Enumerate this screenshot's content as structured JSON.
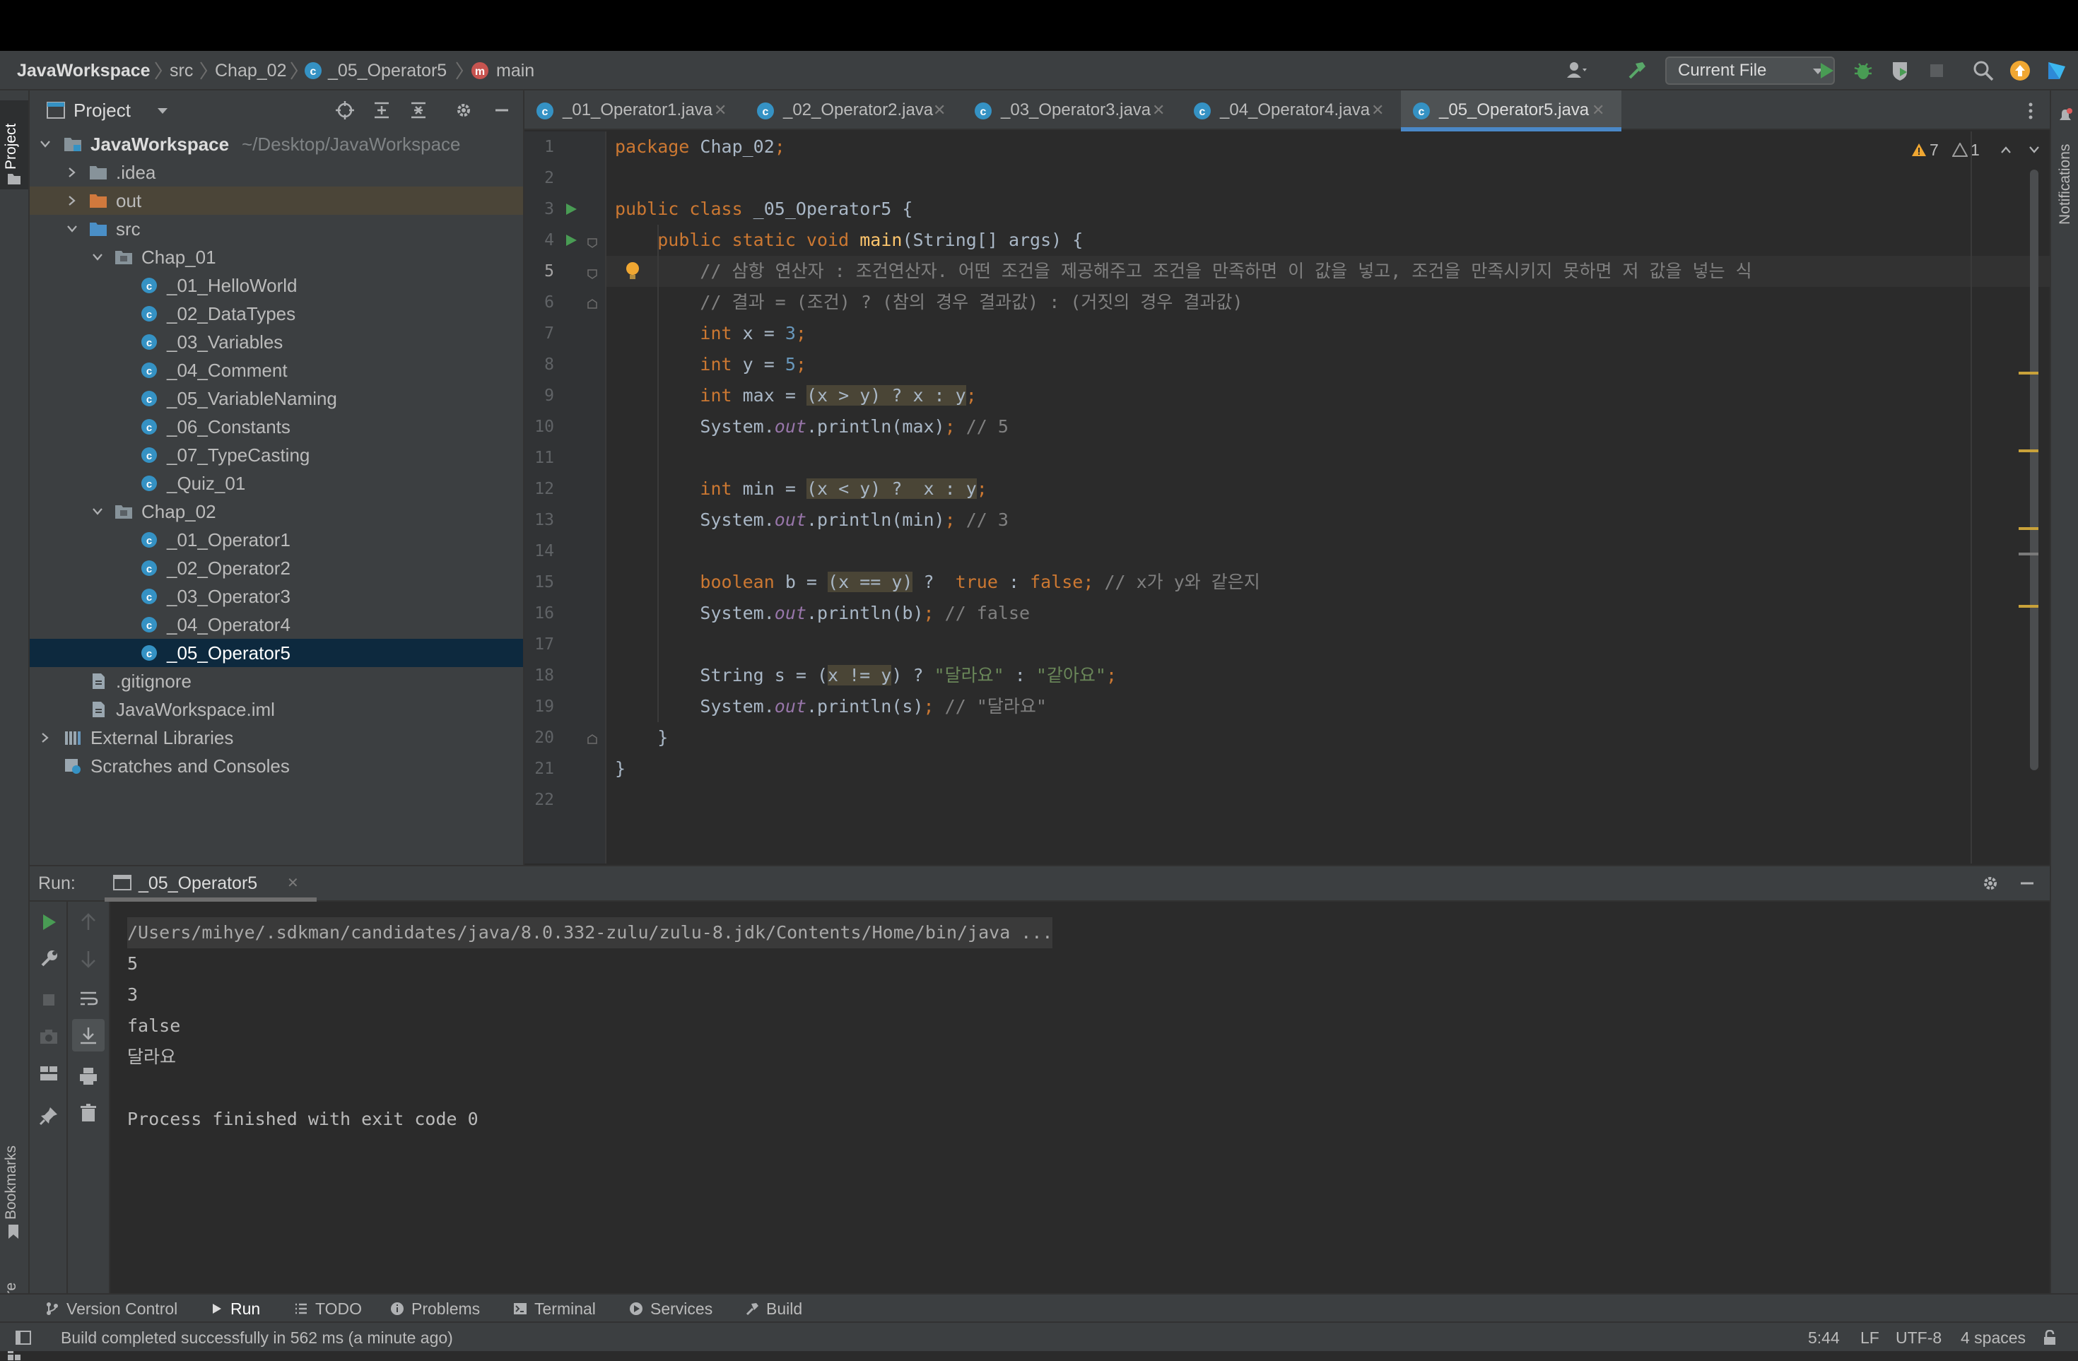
{
  "breadcrumb": {
    "project": "JavaWorkspace",
    "src": "src",
    "package": "Chap_02",
    "file": "_05_Operator5",
    "method": "main"
  },
  "run_config": {
    "label": "Current File"
  },
  "project_panel": {
    "title": "Project",
    "tree": [
      {
        "label": "JavaWorkspace",
        "path": "~/Desktop/JavaWorkspace"
      },
      {
        "label": ".idea"
      },
      {
        "label": "out"
      },
      {
        "label": "src"
      },
      {
        "label": "Chap_01"
      },
      {
        "label": "_01_HelloWorld"
      },
      {
        "label": "_02_DataTypes"
      },
      {
        "label": "_03_Variables"
      },
      {
        "label": "_04_Comment"
      },
      {
        "label": "_05_VariableNaming"
      },
      {
        "label": "_06_Constants"
      },
      {
        "label": "_07_TypeCasting"
      },
      {
        "label": "_Quiz_01"
      },
      {
        "label": "Chap_02"
      },
      {
        "label": "_01_Operator1"
      },
      {
        "label": "_02_Operator2"
      },
      {
        "label": "_03_Operator3"
      },
      {
        "label": "_04_Operator4"
      },
      {
        "label": "_05_Operator5"
      },
      {
        "label": ".gitignore"
      },
      {
        "label": "JavaWorkspace.iml"
      },
      {
        "label": "External Libraries"
      },
      {
        "label": "Scratches and Consoles"
      }
    ]
  },
  "tabs": [
    {
      "label": "_01_Operator1.java"
    },
    {
      "label": "_02_Operator2.java"
    },
    {
      "label": "_03_Operator3.java"
    },
    {
      "label": "_04_Operator4.java"
    },
    {
      "label": "_05_Operator5.java"
    }
  ],
  "inspections": {
    "warnings": "7",
    "weak_warnings": "1"
  },
  "editor": {
    "current_line": 5,
    "lines": [
      {
        "n": "1",
        "t": "package Chap_02;"
      },
      {
        "n": "2",
        "t": ""
      },
      {
        "n": "3",
        "t": "public class _05_Operator5 {"
      },
      {
        "n": "4",
        "t": "    public static void main(String[] args) {"
      },
      {
        "n": "5",
        "t": "        // 삼항 연산자 : 조건연산자. 어떤 조건을 제공해주고 조건을 만족하면 이 값을 넣고, 조건을 만족시키지 못하면 저 값을 넣는 식"
      },
      {
        "n": "6",
        "t": "        // 결과 = (조건) ? (참의 경우 결과값) : (거짓의 경우 결과값)"
      },
      {
        "n": "7",
        "t": "        int x = 3;"
      },
      {
        "n": "8",
        "t": "        int y = 5;"
      },
      {
        "n": "9",
        "t": "        int max = (x > y) ? x : y;"
      },
      {
        "n": "10",
        "t": "        System.out.println(max); // 5"
      },
      {
        "n": "11",
        "t": ""
      },
      {
        "n": "12",
        "t": "        int min = (x < y) ?  x : y;"
      },
      {
        "n": "13",
        "t": "        System.out.println(min); // 3"
      },
      {
        "n": "14",
        "t": ""
      },
      {
        "n": "15",
        "t": "        boolean b = (x == y) ?  true : false; // x가 y와 같은지"
      },
      {
        "n": "16",
        "t": "        System.out.println(b); // false"
      },
      {
        "n": "17",
        "t": ""
      },
      {
        "n": "18",
        "t": "        String s = (x != y) ? \"달라요\" : \"같아요\";"
      },
      {
        "n": "19",
        "t": "        System.out.println(s); // \"달라요\""
      },
      {
        "n": "20",
        "t": "    }"
      },
      {
        "n": "21",
        "t": "}"
      },
      {
        "n": "22",
        "t": ""
      }
    ]
  },
  "run_panel": {
    "label": "Run:",
    "tab": "_05_Operator5",
    "output": [
      "/Users/mihye/.sdkman/candidates/java/8.0.332-zulu/zulu-8.jdk/Contents/Home/bin/java ...",
      "5",
      "3",
      "false",
      "달라요",
      "",
      "Process finished with exit code 0"
    ]
  },
  "side_labels": {
    "project": "Project",
    "bookmarks": "Bookmarks",
    "structure": "Structure",
    "notifications": "Notifications"
  },
  "tool_windows": [
    {
      "label": "Version Control",
      "icon": "branch-icon"
    },
    {
      "label": "Run",
      "icon": "play-icon"
    },
    {
      "label": "TODO",
      "icon": "list-icon"
    },
    {
      "label": "Problems",
      "icon": "info-icon"
    },
    {
      "label": "Terminal",
      "icon": "terminal-icon"
    },
    {
      "label": "Services",
      "icon": "services-icon"
    },
    {
      "label": "Build",
      "icon": "hammer-icon"
    }
  ],
  "status": {
    "message": "Build completed successfully in 562 ms (a minute ago)",
    "position": "5:44",
    "line_sep": "LF",
    "encoding": "UTF-8",
    "indent": "4 spaces"
  },
  "colors": {
    "keyword": "#cc7832",
    "number": "#6897bb",
    "string": "#6a8759",
    "comment": "#808080",
    "field": "#9876aa",
    "method": "#ffc66d",
    "selection": "#0d293e",
    "accent": "#4a88c7"
  }
}
